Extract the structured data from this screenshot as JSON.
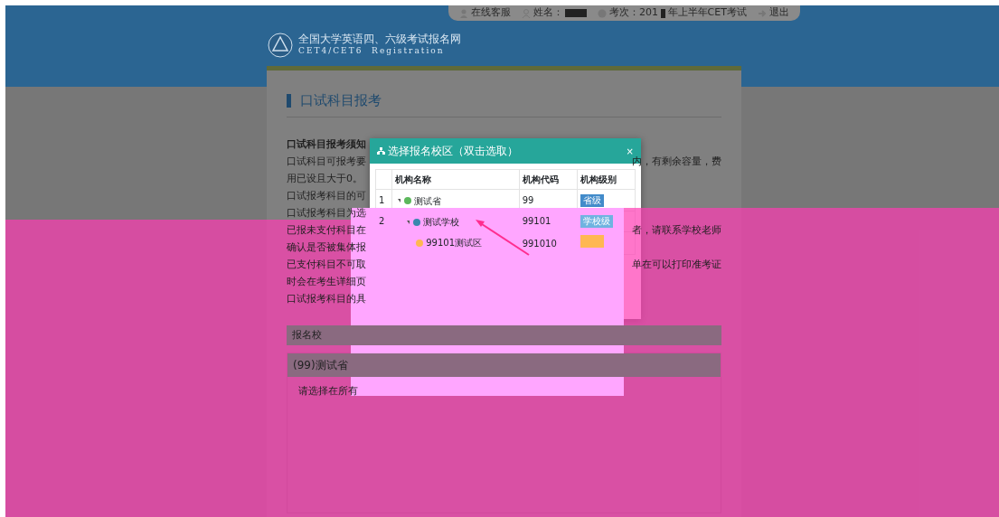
{
  "top_bar": {
    "items": [
      {
        "kind": "support",
        "label": "在线客服"
      },
      {
        "kind": "name",
        "label": "姓名："
      },
      {
        "kind": "exam",
        "label": "考次：201",
        "suffix": "年上半年CET考试"
      },
      {
        "kind": "logout",
        "label": "退出"
      }
    ]
  },
  "logo": {
    "title": "全国大学英语四、六级考试报名网",
    "subtitle": "CET4/CET6  Registration"
  },
  "page_title": "口试科目报考",
  "notes": [
    {
      "left": "口试科目报考须知",
      "bold": true
    },
    {
      "left": "口试科目可报考要",
      "right": "内，有剩余容量，费",
      "bold": false
    },
    {
      "left": "用已设且大于0。",
      "bold": false
    },
    {
      "left": "口试报考科目的可",
      "bold": false
    },
    {
      "left": "口试报考科目为选",
      "bold": false
    },
    {
      "left": "已报未支付科目在",
      "right": "者，请联系学校老师",
      "bold": false
    },
    {
      "left": "确认是否被集体报",
      "bold": false
    },
    {
      "left": "已支付科目不可取",
      "right": "单在可以打印准考证",
      "bold": false
    },
    {
      "left": "时会在考生详细页",
      "bold": false
    },
    {
      "left": "口试报考科目的具",
      "bold": false
    }
  ],
  "panel_label": "报名校",
  "panel": {
    "title": "(99)测试省",
    "body": "请选择在所有"
  },
  "modal": {
    "title": "选择报名校区（双击选取）",
    "close": "×",
    "columns": [
      "机构名称",
      "机构代码",
      "机构级别"
    ],
    "rows": [
      {
        "index": "1",
        "name": "测试省",
        "code": "99",
        "level_label": "省级",
        "color": "#428bca",
        "expanded": true,
        "children": [
          {
            "index": "2",
            "name": "测试学校",
            "code": "99101",
            "level_label": "学校级",
            "color": "#6fb3e0",
            "expanded": true,
            "children": [
              {
                "name": "99101测试区",
                "code": "991010",
                "color": "#ffb752"
              }
            ]
          }
        ]
      }
    ]
  }
}
